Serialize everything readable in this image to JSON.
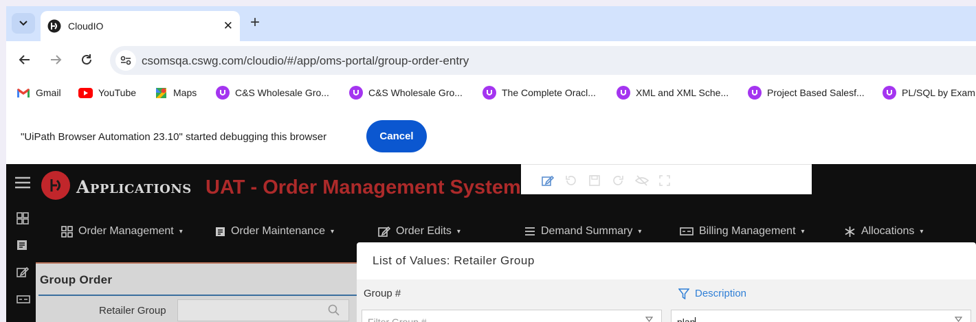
{
  "browser": {
    "tab": {
      "title": "CloudIO",
      "close": "✕"
    },
    "new_tab": "+",
    "url": "csomsqa.cswg.com/cloudio/#/app/oms-portal/group-order-entry",
    "bookmarks": [
      {
        "label": "Gmail",
        "icon": "gmail-icon"
      },
      {
        "label": "YouTube",
        "icon": "youtube-icon"
      },
      {
        "label": "Maps",
        "icon": "maps-icon"
      },
      {
        "label": "C&S Wholesale Gro...",
        "icon": "oracle-u-icon"
      },
      {
        "label": "C&S Wholesale Gro...",
        "icon": "oracle-u-icon"
      },
      {
        "label": "The Complete Oracl...",
        "icon": "oracle-u-icon"
      },
      {
        "label": "XML and XML Sche...",
        "icon": "oracle-u-icon"
      },
      {
        "label": "Project Based Salesf...",
        "icon": "oracle-u-icon"
      },
      {
        "label": "PL/SQL by Exam",
        "icon": "oracle-u-icon"
      }
    ],
    "infobar": {
      "message": "\"UiPath Browser Automation 23.10\" started debugging this browser",
      "cancel": "Cancel"
    },
    "colors": {
      "tabstrip": "#d3e3fd",
      "cancel_button": "#0b57d0"
    }
  },
  "app": {
    "logo_text": "Applications",
    "title": "UAT - Order Management System",
    "menus": [
      {
        "label": "Order Management",
        "icon": "grid-icon"
      },
      {
        "label": "Order Maintenance",
        "icon": "form-icon"
      },
      {
        "label": "Order Edits",
        "icon": "edit-icon"
      },
      {
        "label": "Demand Summary",
        "icon": "list-icon"
      },
      {
        "label": "Billing Management",
        "icon": "billing-icon"
      },
      {
        "label": "Allocations",
        "icon": "asterisk-icon"
      }
    ],
    "caret": "▾",
    "group_order": {
      "title": "Group Order",
      "retailer_group_label": "Retailer Group"
    },
    "colors": {
      "title": "#ad2a2a",
      "logo": "#c1262b"
    }
  },
  "lov": {
    "title": "List of Values: Retailer Group",
    "columns": {
      "group": "Group #",
      "description": "Description"
    },
    "filter_group_placeholder": "Filter Group #",
    "filter_desc_value": "plan",
    "colors": {
      "active_column": "#2f7fd6"
    }
  }
}
